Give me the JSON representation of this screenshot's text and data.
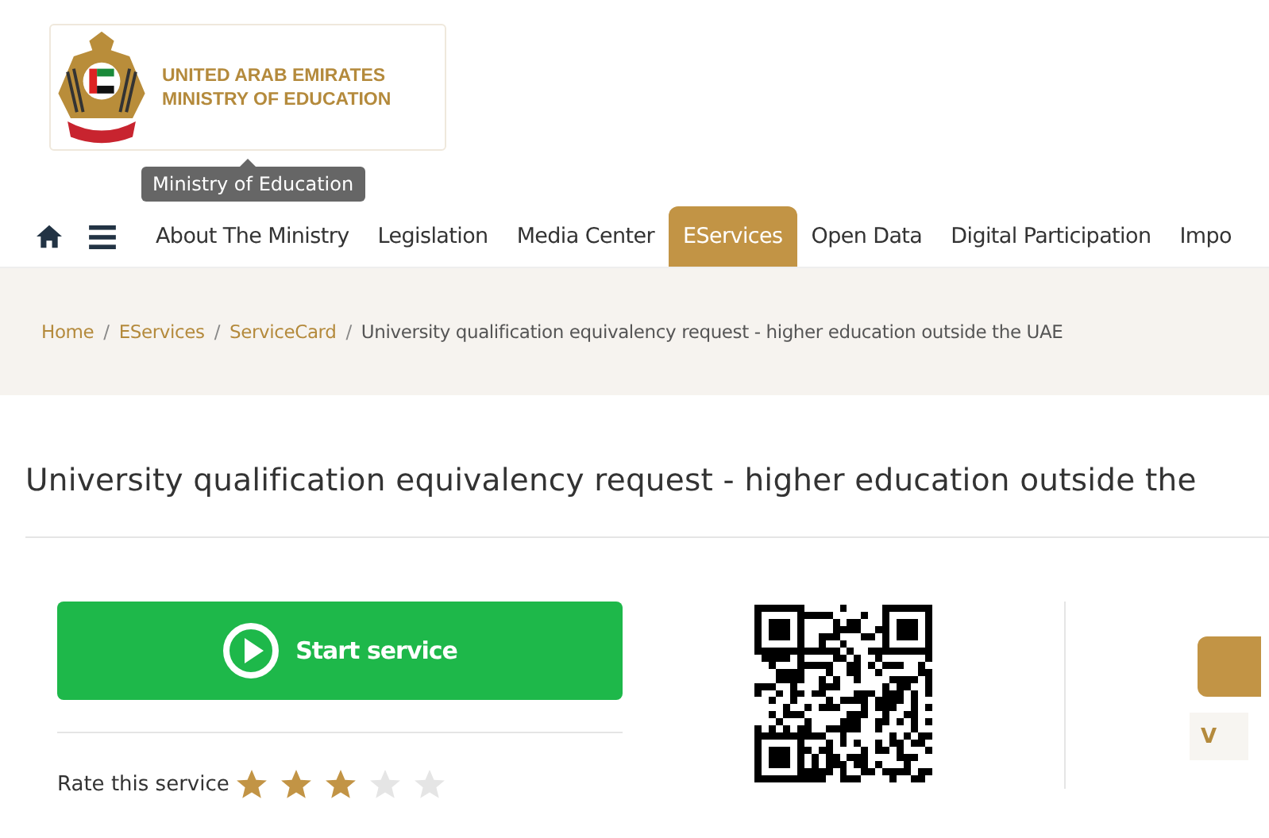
{
  "logo": {
    "line_1": "UNITED ARAB EMIRATES",
    "line_2": "MINISTRY OF EDUCATION"
  },
  "tooltip": "Ministry of Education",
  "nav": {
    "items": [
      {
        "label": "About The Ministry",
        "selected": false
      },
      {
        "label": "Legislation",
        "selected": false
      },
      {
        "label": "Media Center",
        "selected": false
      },
      {
        "label": "EServices",
        "selected": true
      },
      {
        "label": "Open Data",
        "selected": false
      },
      {
        "label": "Digital Participation",
        "selected": false
      },
      {
        "label": "Impo",
        "selected": false
      }
    ]
  },
  "breadcrumb": {
    "links": [
      {
        "label": "Home",
        "separator": "/"
      },
      {
        "label": "EServices",
        "separator": "/"
      },
      {
        "label": "ServiceCard",
        "separator": "/"
      }
    ],
    "current": "University qualification equivalency request - higher education outside the UAE"
  },
  "title": "University qualification equivalency request - higher education outside the",
  "start_button": "Start service",
  "rating": {
    "label": "Rate this service",
    "stars": 3
  },
  "side_panel": {
    "text": "V"
  }
}
